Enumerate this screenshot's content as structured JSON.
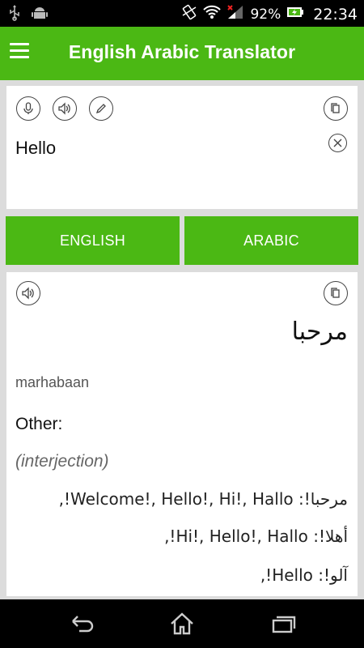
{
  "status_bar": {
    "battery_percent": "92%",
    "time": "22:34",
    "icons": [
      "usb-icon",
      "android-icon",
      "vibrate-icon",
      "wifi-icon",
      "signal-icon",
      "battery-charging-icon"
    ]
  },
  "toolbar": {
    "title": "English Arabic Translator",
    "menu_icon": "menu-icon"
  },
  "input_card": {
    "text": "Hello",
    "actions": [
      "microphone-icon",
      "speaker-icon",
      "pencil-icon",
      "copy-icon",
      "clear-icon"
    ]
  },
  "languages": {
    "source": "ENGLISH",
    "target": "ARABIC"
  },
  "result_card": {
    "translation": "مرحبا",
    "transliteration": "marhabaan",
    "other_label": "Other:",
    "part_of_speech": "(interjection)",
    "alternatives": [
      "مرحبا!: Welcome!, Hello!, Hi!, Hallo!,",
      "أهلا!: Hi!, Hello!, Hallo!,",
      "آلو!: Hello!,"
    ],
    "actions": [
      "speaker-icon",
      "copy-icon"
    ]
  },
  "nav_bar": {
    "icons": [
      "back-icon",
      "home-icon",
      "recent-apps-icon"
    ]
  },
  "colors": {
    "accent": "#4bb814",
    "background": "#dcdcdc",
    "card": "#ffffff"
  }
}
